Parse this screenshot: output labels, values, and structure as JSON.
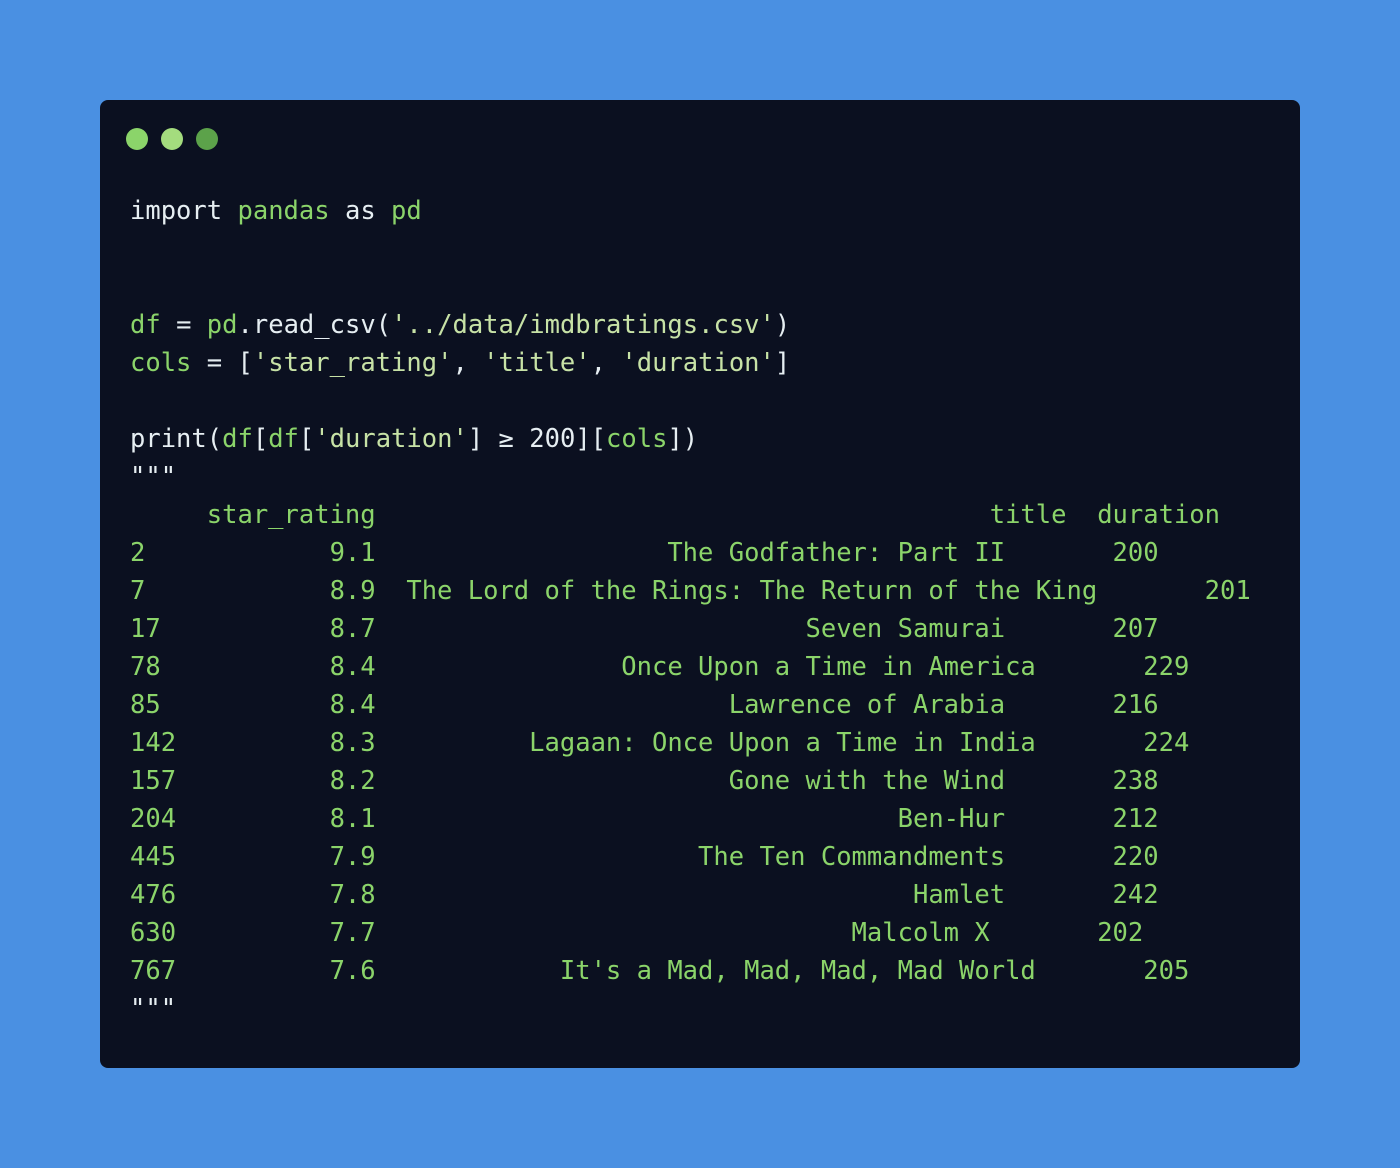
{
  "colors": {
    "background": "#4a90e2",
    "window": "#0b1020",
    "dot_1": "#8bd46a",
    "dot_2": "#a4dc7e",
    "dot_3": "#5ca24a",
    "code_green": "#8bd46a",
    "code_white": "#e6eef2",
    "code_string": "#c7e2a6"
  },
  "code": {
    "import": {
      "kw1": "import",
      "module": "pandas",
      "kw2": "as",
      "alias": "pd"
    },
    "read": {
      "var": "df",
      "eq": "=",
      "obj": "pd",
      "dot": ".",
      "fn": "read_csv",
      "open": "(",
      "arg": "'../data/imdbratings.csv'",
      "close": ")"
    },
    "cols": {
      "var": "cols",
      "eq": "=",
      "open": "[",
      "s1": "'star_rating'",
      "c1": ",",
      "s2": "'title'",
      "c2": ",",
      "s3": "'duration'",
      "close": "]"
    },
    "print": {
      "fn": "print",
      "p1": "(",
      "df1": "df",
      "b1": "[",
      "df2": "df",
      "b2": "[",
      "key": "'duration'",
      "b3": "]",
      "op": "≥",
      "num": "200",
      "b4": "][",
      "cols": "cols",
      "end": "])"
    },
    "docstring_open": "\"\"\"",
    "docstring_close": "\"\"\""
  },
  "output": {
    "header": "     star_rating                                        title  duration",
    "rows": [
      "2            9.1                   The Godfather: Part II       200",
      "7            8.9  The Lord of the Rings: The Return of the King       201",
      "17           8.7                            Seven Samurai       207",
      "78           8.4                Once Upon a Time in America       229",
      "85           8.4                       Lawrence of Arabia       216",
      "142          8.3          Lagaan: Once Upon a Time in India       224",
      "157          8.2                       Gone with the Wind       238",
      "204          8.1                                  Ben-Hur       212",
      "445          7.9                     The Ten Commandments       220",
      "476          7.8                                   Hamlet       242",
      "630          7.7                               Malcolm X       202",
      "767          7.6            It's a Mad, Mad, Mad, Mad World       205"
    ]
  }
}
